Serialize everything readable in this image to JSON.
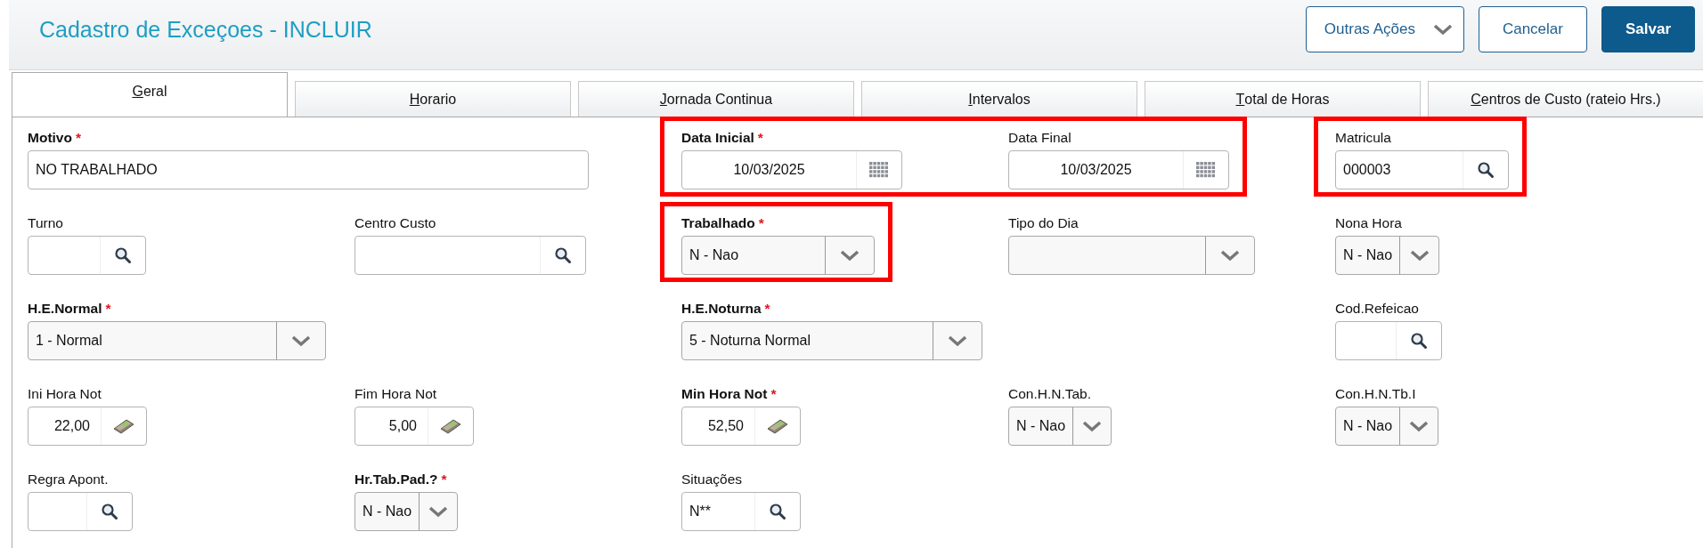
{
  "header": {
    "title": "Cadastro de Exceçoes - INCLUIR",
    "buttons": [
      {
        "label": "Outras Ações",
        "kind": "menu"
      },
      {
        "label": "Cancelar",
        "kind": "secondary"
      },
      {
        "label": "Salvar",
        "kind": "primary"
      }
    ]
  },
  "tabs": [
    {
      "label": "Geral",
      "selected": true
    },
    {
      "label": "Horario",
      "selected": false
    },
    {
      "label": "Jornada Continua",
      "selected": false
    },
    {
      "label": "Intervalos",
      "selected": false
    },
    {
      "label": "Total de Horas",
      "selected": false
    },
    {
      "label": "Centros de Custo (rateio Hrs.)",
      "selected": false
    }
  ],
  "form": {
    "required_mark": "*",
    "rows": [
      [
        {
          "label": "Motivo",
          "kind": "text",
          "value": "NO TRABALHADO",
          "required": true,
          "highlighted": false
        },
        null,
        {
          "label": "Data Inicial",
          "kind": "date",
          "value": "10/03/2025",
          "required": true,
          "highlighted": true
        },
        {
          "label": "Data Final",
          "kind": "date",
          "value": "10/03/2025",
          "required": false,
          "highlighted": true
        },
        {
          "label": "Matricula",
          "kind": "lookup",
          "value": "000003",
          "required": false,
          "highlighted": true
        }
      ],
      [
        {
          "label": "Turno",
          "kind": "lookup",
          "required": false,
          "highlighted": false
        },
        {
          "label": "Centro Custo",
          "kind": "lookup",
          "required": false,
          "highlighted": false
        },
        {
          "label": "Trabalhado",
          "kind": "select",
          "value": "N - Nao",
          "required": true,
          "highlighted": true
        },
        {
          "label": "Tipo do Dia",
          "kind": "select",
          "required": false,
          "highlighted": false
        },
        {
          "label": "Nona Hora",
          "kind": "select",
          "value": "N - Nao",
          "required": false,
          "highlighted": false
        }
      ],
      [
        {
          "label": "H.E.Normal",
          "kind": "select",
          "value": "1 - Normal",
          "required": true,
          "highlighted": false
        },
        null,
        {
          "label": "H.E.Noturna",
          "kind": "select",
          "value": "5 - Noturna Normal",
          "required": true,
          "highlighted": false
        },
        null,
        {
          "label": "Cod.Refeicao",
          "kind": "lookup",
          "required": false,
          "highlighted": false
        }
      ],
      [
        {
          "label": "Ini Hora Not",
          "kind": "number",
          "value": "22,00",
          "required": false,
          "highlighted": false
        },
        {
          "label": "Fim Hora Not",
          "kind": "number",
          "value": "5,00",
          "required": false,
          "highlighted": false
        },
        {
          "label": "Min Hora Not",
          "kind": "number",
          "value": "52,50",
          "required": true,
          "highlighted": false
        },
        {
          "label": "Con.H.N.Tab.",
          "kind": "select",
          "value": "N - Nao",
          "required": false,
          "highlighted": false
        },
        {
          "label": "Con.H.N.Tb.I",
          "kind": "select",
          "value": "N - Nao",
          "required": false,
          "highlighted": false
        }
      ],
      [
        {
          "label": "Regra Apont.",
          "kind": "lookup",
          "required": false,
          "highlighted": false
        },
        {
          "label": "Hr.Tab.Pad.?",
          "kind": "select",
          "value": "N - Nao",
          "required": true,
          "highlighted": false
        },
        {
          "label": "Situações",
          "kind": "lookup",
          "value": "N**",
          "required": false,
          "highlighted": false
        },
        null,
        null
      ]
    ]
  }
}
